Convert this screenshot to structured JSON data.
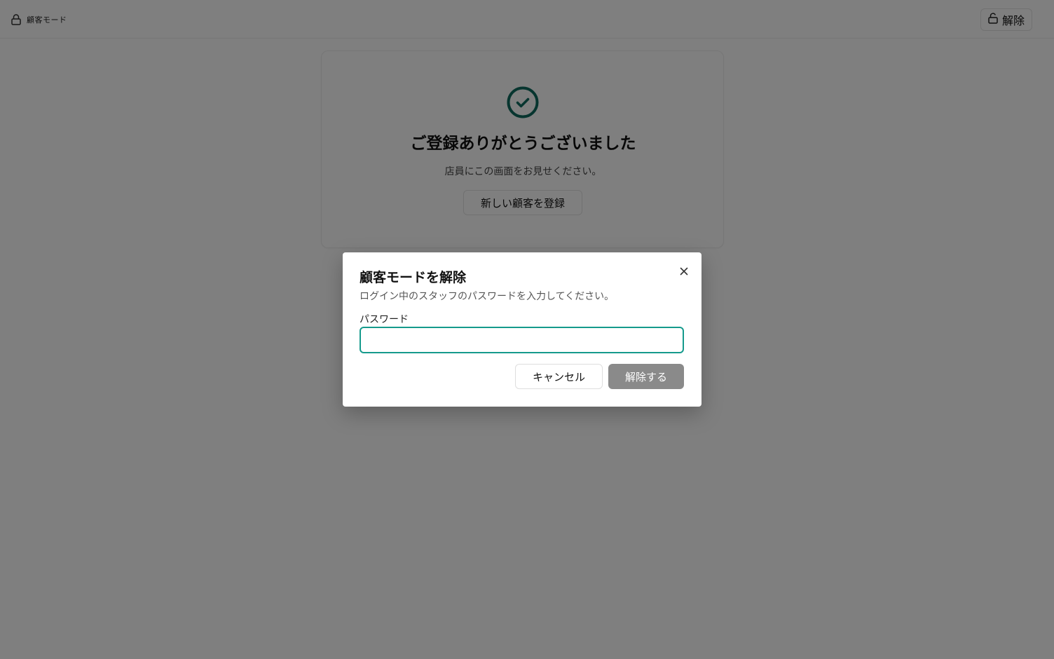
{
  "header": {
    "mode_icon": "lock-icon",
    "mode_label": "顧客モード",
    "unlock_icon": "unlock-icon",
    "unlock_label": "解除"
  },
  "card": {
    "icon": "check-circle-icon",
    "title": "ご登録ありがとうございました",
    "subtitle": "店員にこの画面をお見せください。",
    "new_button_label": "新しい顧客を登録"
  },
  "dialog": {
    "title": "顧客モードを解除",
    "description": "ログイン中のスタッフのパスワードを入力してください。",
    "close_icon": "close-icon",
    "password_label": "パスワード",
    "password_value": "",
    "password_placeholder": "",
    "cancel_label": "キャンセル",
    "confirm_label": "解除する"
  },
  "colors": {
    "accent": "#159a8c",
    "check": "#0f6b5f",
    "overlay": "rgba(0,0,0,0.5)",
    "confirm_disabled": "#8a8a8a"
  }
}
